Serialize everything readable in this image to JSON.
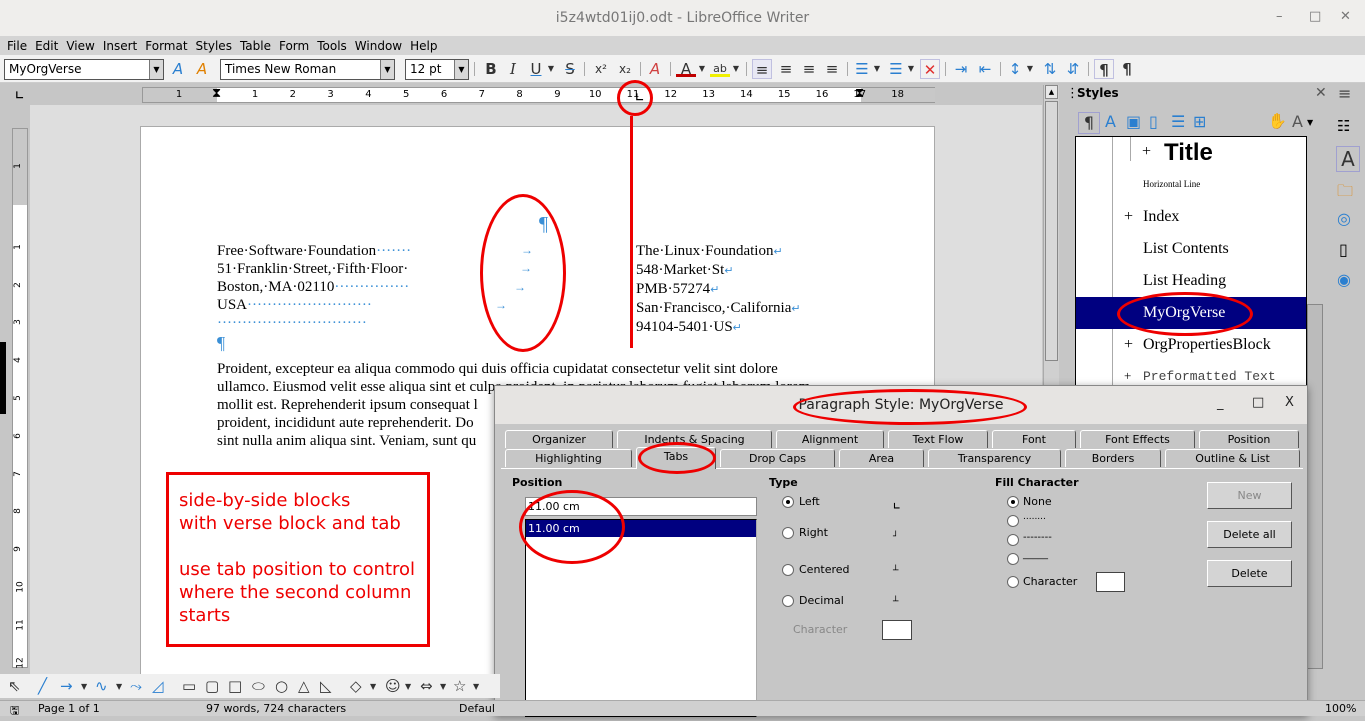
{
  "window": {
    "title": "i5z4wtd01ij0.odt - LibreOffice Writer",
    "minimize": "–",
    "maximize": "□",
    "close": "✕"
  },
  "menu": [
    "File",
    "Edit",
    "View",
    "Insert",
    "Format",
    "Styles",
    "Table",
    "Form",
    "Tools",
    "Window",
    "Help"
  ],
  "toolbar": {
    "paragraph_style": "MyOrgVerse",
    "font_name": "Times New Roman",
    "font_size": "12 pt",
    "buttons": {
      "bold": "B",
      "italic": "I",
      "underline": "U",
      "strike": "S",
      "superscript": "x²",
      "subscript": "x₂",
      "pilcrow_ltr": "¶",
      "pilcrow_rtl": "¶"
    }
  },
  "ruler": {
    "h_left_numbers": [
      "1"
    ],
    "h_numbers": [
      "1",
      "2",
      "3",
      "4",
      "5",
      "6",
      "7",
      "8",
      "9",
      "10",
      "11",
      "12",
      "13",
      "14",
      "15",
      "16",
      "17",
      "18"
    ],
    "v_numbers": [
      "1",
      "1",
      "2",
      "3",
      "4",
      "5",
      "6",
      "7",
      "8",
      "9",
      "10",
      "11",
      "12"
    ]
  },
  "document": {
    "left_block": [
      "Free·Software·Foundation",
      "51·Franklin·Street,·Fifth·Floor·",
      "Boston,·MA·02110",
      "USA"
    ],
    "left_fill": [
      "·······",
      "",
      "···············",
      "·························",
      "······························"
    ],
    "right_block": [
      "The·Linux·Foundation",
      "548·Market·St",
      "PMB·57274",
      "San·Francisco,·California",
      "94104-5401·US"
    ],
    "pilcrow": "¶",
    "tab_arrow": "→",
    "line_break": "↵",
    "body_lines": [
      "Proident, excepteur ea aliqua commodo qui duis officia cupidatat consectetur velit sint dolore",
      "ullamco. Eiusmod velit esse aliqua sint et culpa proident, in pariatur laborum fugiat laborum lorem",
      "mollit est. Reprehenderit ipsum consequat l",
      "proident, incididunt aute reprehenderit. Do",
      "sint nulla anim aliqua sint. Veniam, sunt qu"
    ]
  },
  "annotation": {
    "text": "side-by-side blocks\nwith verse block and tab\n\nuse tab position to control\nwhere the second column\nstarts",
    "color": "#e00000"
  },
  "sidebar": {
    "title": "Styles",
    "close": "✕",
    "menu": "≡",
    "styles": [
      {
        "name": "Title",
        "expand": "+"
      },
      {
        "name": "Horizontal Line",
        "expand": ""
      },
      {
        "name": "Index",
        "expand": "+"
      },
      {
        "name": "List Contents",
        "expand": ""
      },
      {
        "name": "List Heading",
        "expand": ""
      },
      {
        "name": "MyOrgVerse",
        "expand": "",
        "selected": true
      },
      {
        "name": "OrgPropertiesBlock",
        "expand": "+"
      },
      {
        "name": "Preformatted Text",
        "expand": "+"
      }
    ],
    "selected_color": "#000080"
  },
  "dialog": {
    "title": "Paragraph Style: MyOrgVerse",
    "controls": {
      "minimize": "_",
      "maximize": "□",
      "close": "X"
    },
    "tabs_row1": [
      "Organizer",
      "Indents & Spacing",
      "Alignment",
      "Text Flow",
      "Font",
      "Font Effects",
      "Position"
    ],
    "tabs_row2": [
      "Highlighting",
      "Tabs",
      "Drop Caps",
      "Area",
      "Transparency",
      "Borders",
      "Outline & List"
    ],
    "active_tab": "Tabs",
    "position": {
      "label": "Position",
      "value": "11.00 cm",
      "list": [
        "11.00 cm"
      ]
    },
    "type": {
      "label": "Type",
      "options": [
        "Left",
        "Right",
        "Centered",
        "Decimal"
      ],
      "selected": "Left",
      "character_label": "Character"
    },
    "fill": {
      "label": "Fill Character",
      "options": [
        "None",
        "........",
        "--------",
        "_____",
        "Character"
      ],
      "selected": "None"
    },
    "buttons": {
      "new": "New",
      "delete_all": "Delete all",
      "delete": "Delete"
    }
  },
  "status": {
    "page": "Page 1 of 1",
    "words": "97 words, 724 characters",
    "style": "Defaul",
    "zoom": "100%"
  }
}
